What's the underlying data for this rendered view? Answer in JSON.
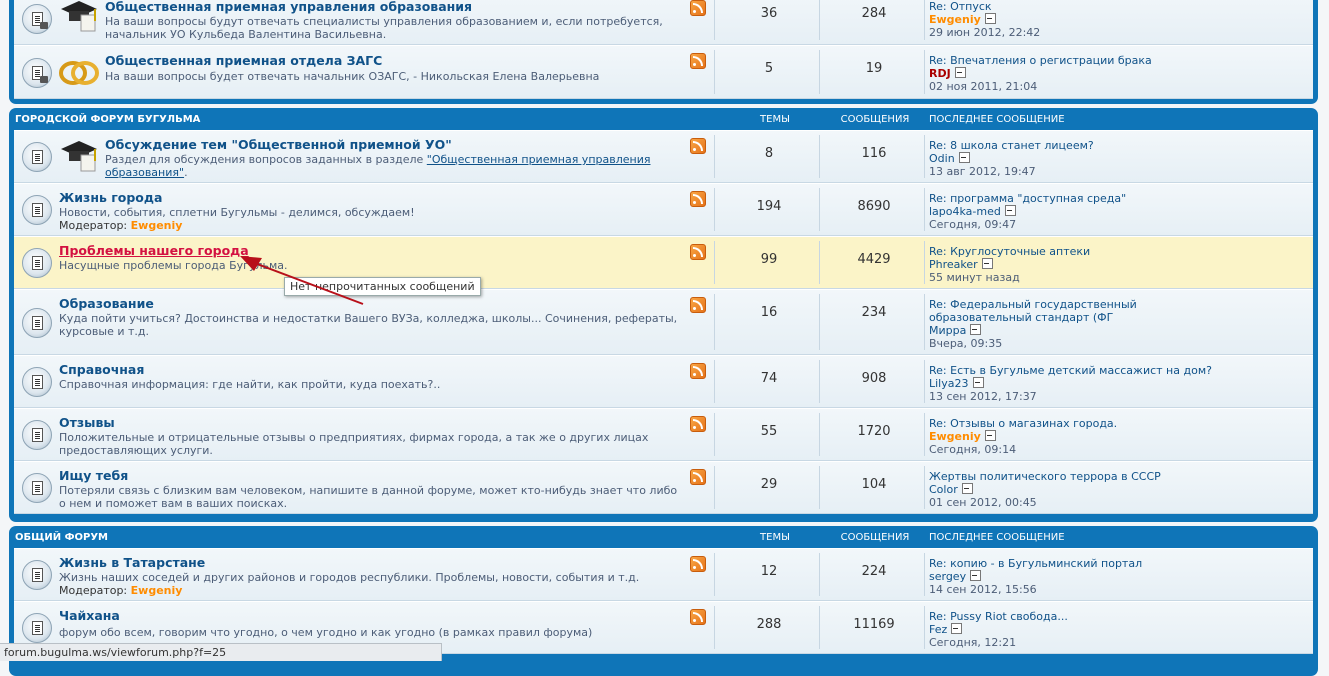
{
  "categories": [
    {
      "title": "",
      "rows": [
        {
          "title": "Общественная приемная управления образования",
          "desc": [
            "На ваши вопросы будут отвечать специалисты управления образованием и, если потребуется,",
            "начальник УО Кульбеда Валентина Васильевна."
          ],
          "topics": "36",
          "posts": "284",
          "last": {
            "title": "Re: Отпуск",
            "user": "Ewgeniy",
            "date": "29 июн 2012, 22:42"
          }
        },
        {
          "title": "Общественная приемная отдела ЗАГС",
          "desc": [
            "На ваши вопросы будет отвечать начальник ОЗАГС, - Никольская Елена Валерьевна"
          ],
          "topics": "5",
          "posts": "19",
          "last": {
            "title": "Re: Впечатления о регистрации брака",
            "user": "RDJ",
            "date": "02 ноя 2011, 21:04"
          }
        }
      ]
    },
    {
      "title": "ГОРОДСКОЙ ФОРУМ БУГУЛЬМА",
      "col_topics": "ТЕМЫ",
      "col_posts": "СООБЩЕНИЯ",
      "col_last": "ПОСЛЕДНЕЕ СООБЩЕНИЕ",
      "rows": [
        {
          "title": "Обсуждение тем \"Общественной приемной УО\"",
          "desc_pre": "Раздел для обсуждения вопросов заданных в разделе ",
          "desc_link1": "\"Общественная приемная управления",
          "desc_link2": "образования\"",
          "desc_post": ".",
          "topics": "8",
          "posts": "116",
          "last": {
            "title": "Re: 8 школа станет лицеем?",
            "user": "Odin",
            "date": "13 авг 2012, 19:47"
          }
        },
        {
          "title": "Жизнь города",
          "desc": [
            "Новости, события, сплетни Бугульмы - делимся, обсуждаем!"
          ],
          "mod_label": "Модератор:",
          "mod": "Ewgeniy",
          "topics": "194",
          "posts": "8690",
          "last": {
            "title": "Re: программа \"доступная среда\"",
            "user": "lapo4ka-med",
            "date": "Сегодня, 09:47"
          }
        },
        {
          "title": "Проблемы нашего города",
          "desc": [
            "Насущные проблемы города Бугульма."
          ],
          "topics": "99",
          "posts": "4429",
          "last": {
            "title": "Re: Круглосуточные аптеки",
            "user": "Phreaker",
            "date": "55 минут назад"
          }
        },
        {
          "title": "Образование",
          "desc": [
            "Куда пойти учиться? Достоинства и недостатки Вашего ВУЗа, колледжа, школы... Сочинения, рефераты,",
            "курсовые и т.д."
          ],
          "topics": "16",
          "posts": "234",
          "last": {
            "title": "Re: Федеральный государственный",
            "title2": "образовательный стандарт (ФГ",
            "user": "Мирра",
            "date": "Вчера, 09:35"
          }
        },
        {
          "title": "Справочная",
          "desc": [
            "Справочная информация: где найти, как пройти, куда поехать?.."
          ],
          "topics": "74",
          "posts": "908",
          "last": {
            "title": "Re: Есть в Бугульме детский массажист на дом?",
            "user": "Lilya23",
            "date": "13 сен 2012, 17:37"
          }
        },
        {
          "title": "Отзывы",
          "desc": [
            "Положительные и отрицательные отзывы о предприятиях, фирмах города, а так же о других лицах",
            "предоставляющих услуги."
          ],
          "topics": "55",
          "posts": "1720",
          "last": {
            "title": "Re: Отзывы о магазинах города.",
            "user": "Ewgeniy",
            "date": "Сегодня, 09:14"
          }
        },
        {
          "title": "Ищу тебя",
          "desc": [
            "Потеряли связь с близким вам человеком, напишите в данной форуме, может кто-нибудь знает что либо",
            "о нем и поможет вам в ваших поисках."
          ],
          "topics": "29",
          "posts": "104",
          "last": {
            "title": "Жертвы политического террора в СССР",
            "user": "Color",
            "date": "01 сен 2012, 00:45"
          }
        }
      ]
    },
    {
      "title": "ОБЩИЙ ФОРУМ",
      "col_topics": "ТЕМЫ",
      "col_posts": "СООБЩЕНИЯ",
      "col_last": "ПОСЛЕДНЕЕ СООБЩЕНИЕ",
      "rows": [
        {
          "title": "Жизнь в Татарстане",
          "desc": [
            "Жизнь наших соседей и других районов и городов республики. Проблемы, новости, события и т.д."
          ],
          "mod_label": "Модератор:",
          "mod": "Ewgeniy",
          "topics": "12",
          "posts": "224",
          "last": {
            "title": "Re: копию - в Бугульминский портал",
            "user": "sergey",
            "date": "14 сен 2012, 15:56"
          }
        },
        {
          "title": "Чайхана",
          "desc": [
            "форум обо всем, говорим что угодно, о чем угодно и как угодно (в рамках правил форума)"
          ],
          "topics": "288",
          "posts": "11169",
          "last": {
            "title": "Re: Pussy Riot свобода...",
            "user": "Fez",
            "date": "Сегодня, 12:21"
          }
        }
      ]
    }
  ],
  "tooltip": "Нет непрочитанных сообщений",
  "status_url": "forum.bugulma.ws/viewforum.php?f=25",
  "colors": {
    "header": "#0f75b8",
    "title": "#105289",
    "hot": "#d31141",
    "moderator": "#ff8c00",
    "highlight": "#fbf4c8"
  }
}
